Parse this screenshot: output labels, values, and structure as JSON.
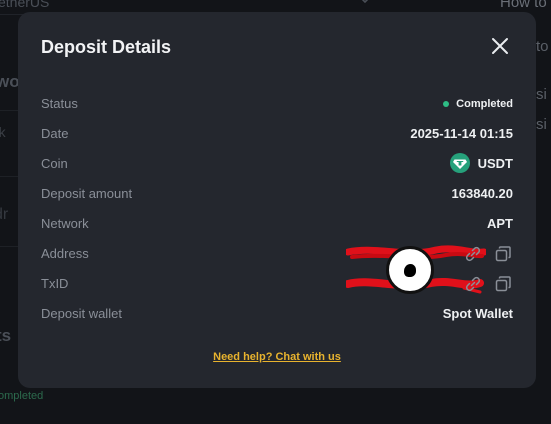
{
  "background": {
    "select_text": "etherUS",
    "right_heading": "How to",
    "right_frag_1": "to",
    "right_frag_2": "si",
    "right_frag_3": "si",
    "left_heading": "wo",
    "left_label_1": "rk",
    "left_label_2": "dr",
    "left_heading_2": "ts",
    "left_status": "ompleted"
  },
  "modal": {
    "title": "Deposit Details",
    "rows": [
      {
        "label": "Status",
        "value": "Completed"
      },
      {
        "label": "Date",
        "value": "2025-11-14 01:15"
      },
      {
        "label": "Coin",
        "value": "USDT",
        "icon": "tether-icon"
      },
      {
        "label": "Deposit amount",
        "value": "163840.20"
      },
      {
        "label": "Network",
        "value": "APT"
      },
      {
        "label": "Address",
        "value": ""
      },
      {
        "label": "TxID",
        "value": ""
      },
      {
        "label": "Deposit wallet",
        "value": "Spot Wallet"
      }
    ],
    "help_link": "Need help? Chat with us"
  },
  "colors": {
    "status_green": "#2ebd85",
    "accent_yellow": "#e8b32e",
    "tether_teal": "#26a17b",
    "redaction_red": "#e0101a"
  },
  "icons": [
    "close-icon",
    "tether-icon",
    "link-icon",
    "copy-icon",
    "chevron-down-icon"
  ]
}
